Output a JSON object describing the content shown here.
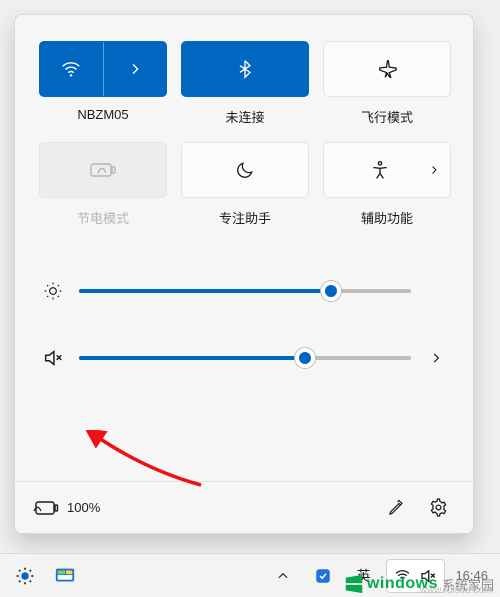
{
  "tiles": {
    "wifi": {
      "label": "NBZM05",
      "active": true,
      "expandable": true
    },
    "bluetooth": {
      "label": "未连接",
      "active": true,
      "expandable": false
    },
    "airplane": {
      "label": "飞行模式",
      "active": false,
      "expandable": false
    },
    "battery": {
      "label": "节电模式",
      "active": false,
      "disabled": true
    },
    "focus": {
      "label": "专注助手",
      "active": false,
      "expandable": false
    },
    "access": {
      "label": "辅助功能",
      "active": false,
      "expandable": true
    }
  },
  "sliders": {
    "brightness": {
      "value": 76,
      "min": 0,
      "max": 100
    },
    "volume": {
      "value": 68,
      "min": 0,
      "max": 100,
      "muted": true
    }
  },
  "footer": {
    "battery_text": "100%"
  },
  "taskbar": {
    "ime_mode": "英",
    "clock": "16:46"
  },
  "watermark": {
    "brand": "windows",
    "suffix": "系统家园",
    "host": "www.ruisifu.com"
  },
  "colors": {
    "accent": "#0067c0",
    "red": "#e11",
    "green": "#07a84e"
  }
}
